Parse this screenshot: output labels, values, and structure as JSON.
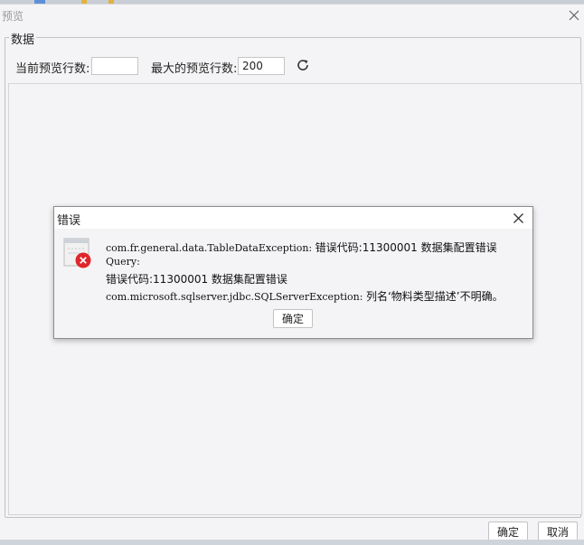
{
  "window": {
    "title": "预览"
  },
  "data_panel": {
    "legend": "数据",
    "current_rows_label": "当前预览行数:",
    "current_rows_value": "",
    "max_rows_label": "最大的预览行数:",
    "max_rows_value": "200"
  },
  "footer": {
    "ok_label": "确定",
    "cancel_label": "取消"
  },
  "error_dialog": {
    "title": "错误",
    "line1_code": "com.fr.general.data.TableDataException:",
    "line1_text": "错误代码:11300001 数据集配置错误",
    "line2": "Query:",
    "line3": "错误代码:11300001 数据集配置错误",
    "line4_code": "com.microsoft.sqlserver.jdbc.SQLServerException:",
    "line4_text": "列名‘物料类型描述’不明确。",
    "ok_label": "确定"
  },
  "icons": {
    "close": "close-icon",
    "refresh": "refresh-icon",
    "error": "error-icon"
  },
  "colors": {
    "error_red": "#e0262b",
    "window_bg": "#f4f4f6"
  }
}
